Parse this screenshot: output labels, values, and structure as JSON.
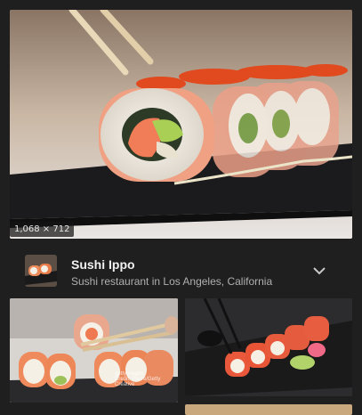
{
  "main_image": {
    "dimensions_label": "1,068 × 712"
  },
  "result": {
    "title": "Sushi Ippo",
    "subtitle": "Sushi restaurant in Los Angeles, California",
    "expand_icon": "chevron-down-icon"
  },
  "grid": {
    "left_watermark": "gettyimages",
    "left_watermark_credit": "Credit: Pierre/Getty Creative"
  },
  "colors": {
    "background": "#1f1f1f",
    "title_text": "#f1f1f1",
    "subtitle_text": "#b0b0b0"
  }
}
